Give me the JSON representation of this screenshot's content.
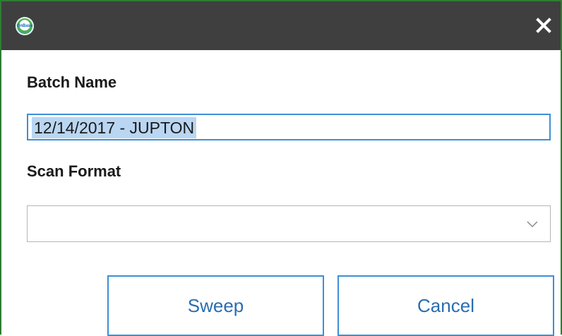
{
  "window": {
    "logo_text": "OnBase",
    "close_icon": "close-icon"
  },
  "form": {
    "batch_name_label": "Batch Name",
    "batch_name_value": "12/14/2017 - JUPTON",
    "scan_format_label": "Scan Format",
    "scan_format_value": ""
  },
  "buttons": {
    "sweep_label": "Sweep",
    "cancel_label": "Cancel"
  },
  "colors": {
    "titlebar": "#3f3f3f",
    "accent": "#3c8fd6",
    "selection": "#b9d6f2",
    "window_border": "#2e7d32"
  }
}
